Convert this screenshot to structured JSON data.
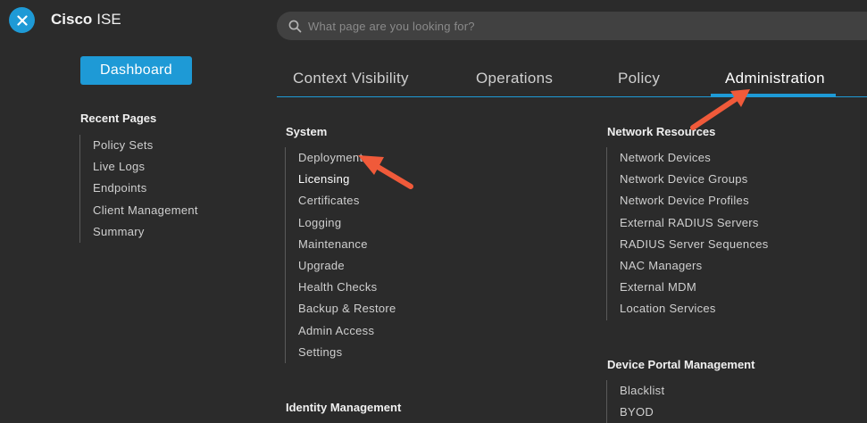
{
  "header": {
    "brand_bold": "Cisco",
    "brand_light": "ISE",
    "search_placeholder": "What page are you looking for?"
  },
  "sidebar": {
    "dashboard_label": "Dashboard",
    "recent_heading": "Recent Pages",
    "recent_items": [
      "Policy Sets",
      "Live Logs",
      "Endpoints",
      "Client Management",
      "Summary"
    ]
  },
  "tabs": [
    {
      "label": "Context Visibility",
      "active": false
    },
    {
      "label": "Operations",
      "active": false
    },
    {
      "label": "Policy",
      "active": false
    },
    {
      "label": "Administration",
      "active": true
    }
  ],
  "system": {
    "heading": "System",
    "items": [
      "Deployment",
      "Licensing",
      "Certificates",
      "Logging",
      "Maintenance",
      "Upgrade",
      "Health Checks",
      "Backup & Restore",
      "Admin Access",
      "Settings"
    ]
  },
  "identity": {
    "heading": "Identity Management"
  },
  "network": {
    "heading": "Network Resources",
    "items": [
      "Network Devices",
      "Network Device Groups",
      "Network Device Profiles",
      "External RADIUS Servers",
      "RADIUS Server Sequences",
      "NAC Managers",
      "External MDM",
      "Location Services"
    ]
  },
  "portal": {
    "heading": "Device Portal Management",
    "items": [
      "Blacklist",
      "BYOD"
    ]
  },
  "colors": {
    "accent": "#1e9ad6",
    "annotation_arrow": "#f05a3a",
    "background": "#2b2b2b"
  }
}
